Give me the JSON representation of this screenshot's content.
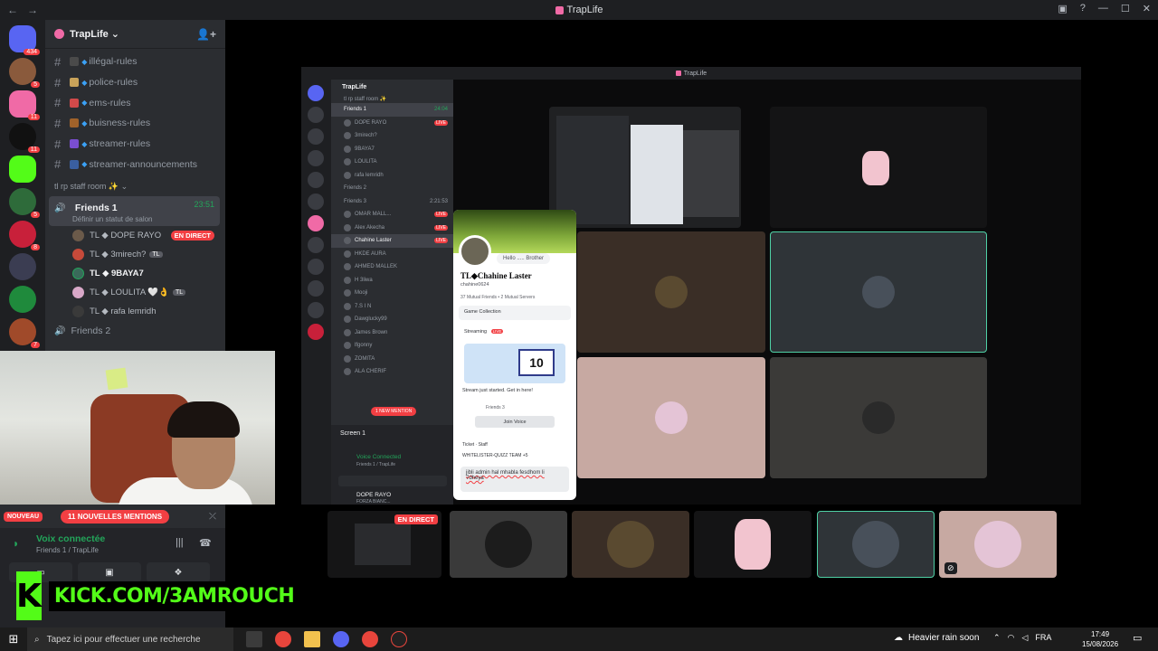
{
  "window": {
    "title": "TrapLife",
    "nav_back": "←",
    "nav_fwd": "→"
  },
  "servers": {
    "home_badge": "434",
    "badges": [
      "5",
      "11",
      "11",
      "5",
      "8",
      "7"
    ]
  },
  "guild": {
    "name": "TrapLife"
  },
  "channels": [
    {
      "label": "illégal-rules",
      "emoji_color": "#4a4a4a"
    },
    {
      "label": "police-rules",
      "emoji_color": "#c9a35a"
    },
    {
      "label": "ems-rules",
      "emoji_color": "#d14a4a"
    },
    {
      "label": "buisness-rules",
      "emoji_color": "#a0622a"
    },
    {
      "label": "streamer-rules",
      "emoji_color": "#7a4ed1"
    },
    {
      "label": "streamer-announcements",
      "emoji_color": "#3a5fa0"
    }
  ],
  "category": {
    "label": "tl rp staff room ✨"
  },
  "voice_channel": {
    "name": "Friends 1",
    "status": "Définir un statut de salon",
    "time": "23:51"
  },
  "members": [
    {
      "name": "TL ◆ DOPE RAYO",
      "badge": "EN DIRECT"
    },
    {
      "name": "TL ◆ 3mirech?",
      "badge": "TL"
    },
    {
      "name": "TL ◆ 9BAYA7",
      "badge": ""
    },
    {
      "name": "TL ◆ LOULITA 🤍👌",
      "badge": "TL"
    },
    {
      "name": "TL ◆ rafa lemridh",
      "badge": ""
    }
  ],
  "voice_channel_2": {
    "name": "Friends 2"
  },
  "mentions": {
    "new_label": "NOUVEAU",
    "count_label": "11 NOUVELLES MENTIONS"
  },
  "voice_status": {
    "title": "Voix connectée",
    "subtitle": "Friends 1 / TrapLife"
  },
  "kick": {
    "logo": "K",
    "url": "KICK.COM/3AMROUCH"
  },
  "inner": {
    "title": "TrapLife",
    "guild": "TrapLife",
    "category": "tl rp staff room ✨",
    "rows": [
      {
        "name": "Friends 1",
        "kind": "hd",
        "time": "24:04"
      },
      {
        "name": "DOPE RAYO",
        "live": "LIVE"
      },
      {
        "name": "3mirech?",
        "live": ""
      },
      {
        "name": "9BAYA7",
        "live": ""
      },
      {
        "name": "LOULITA",
        "live": ""
      },
      {
        "name": "rafa lemridh",
        "live": ""
      },
      {
        "name": "Friends 2",
        "kind": "hd",
        "time": ""
      },
      {
        "name": "Friends 3",
        "kind": "hd",
        "time": "2:21:53"
      },
      {
        "name": "OMAR MALL...",
        "live": "LIVE"
      },
      {
        "name": "Alex Akecha",
        "live": "LIVE"
      },
      {
        "name": "Chahine Laster",
        "live": "LIVE"
      },
      {
        "name": "HKDE AURA",
        "live": ""
      },
      {
        "name": "AHMED MALLEK",
        "live": ""
      },
      {
        "name": "H 3liwa",
        "live": ""
      },
      {
        "name": "Mooji",
        "live": ""
      },
      {
        "name": "7.S I N",
        "live": ""
      },
      {
        "name": "Dawglucky99",
        "live": ""
      },
      {
        "name": "James Brown",
        "live": ""
      },
      {
        "name": "lfgonny",
        "live": ""
      },
      {
        "name": "ZOMITA",
        "live": ""
      },
      {
        "name": "ALA CHERIF",
        "live": ""
      }
    ],
    "new_mention": "1 NEW MENTION",
    "screen_label": "Screen 1",
    "voice_connected": "Voice Connected",
    "voice_sub": "Friends 1 / TrapLife",
    "user_name": "DOPE RAYO",
    "user_sub": "FORZA BIANC..."
  },
  "profile": {
    "bubble": "Hello ..... Brother",
    "name": "TL◆Chahine Laster",
    "username": "chahine0624",
    "mutual": "37 Mutual Friends • 2 Mutual Servers",
    "game_collection": "Game Collection",
    "streaming": "Streaming",
    "live": "LIVE",
    "stream_number": "10",
    "stream_text": "Stream just started. Get in here!",
    "channel": "Friends 3",
    "join_voice": "Join Voice",
    "roles": [
      "Ticket",
      "Staff",
      "WHITELISTER-QUIZZ TEAM",
      "+5"
    ],
    "message": "jibli admin hal mhabla fesdhom li 7dheya"
  },
  "strip": {
    "live": "EN DIRECT"
  },
  "taskbar": {
    "search_placeholder": "Tapez ici pour effectuer une recherche",
    "weather": "Heavier rain soon",
    "lang": "FRA",
    "time": "17:49",
    "date": "15/08/2026"
  },
  "colors": {
    "brand_pink": "#f06aa6",
    "live_red": "#f23f43",
    "voice_green": "#23a55a",
    "kick_green": "#53fc18"
  }
}
